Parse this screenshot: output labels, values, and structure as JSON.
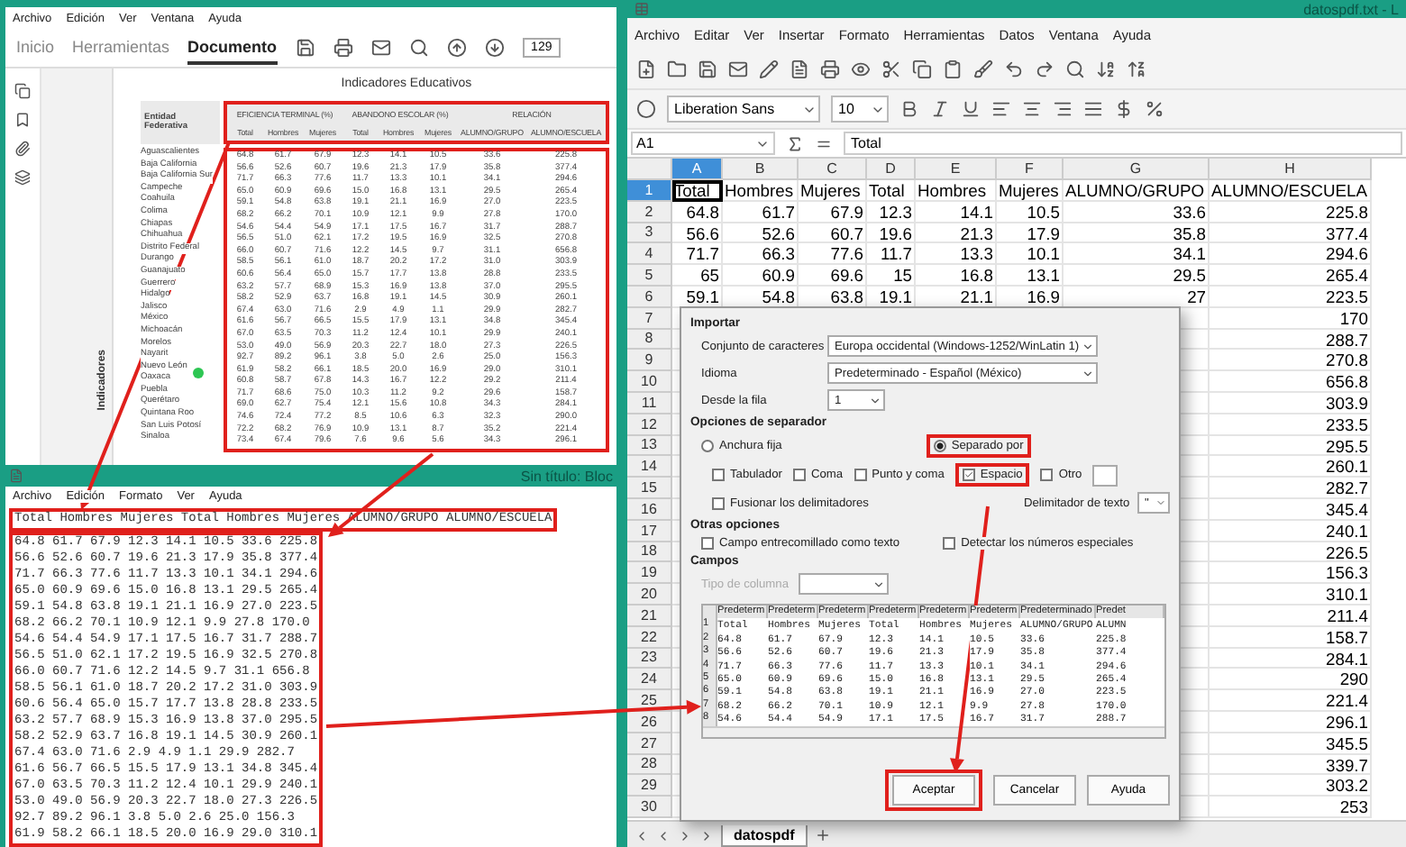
{
  "pdf_viewer": {
    "menu": [
      "Archivo",
      "Edición",
      "Ver",
      "Ventana",
      "Ayuda"
    ],
    "tabs": [
      {
        "label": "Inicio",
        "selected": false
      },
      {
        "label": "Herramientas",
        "selected": false
      },
      {
        "label": "Documento",
        "selected": true
      }
    ],
    "page_number": "129",
    "side_panel_label": "Indicadores",
    "document_title": "Indicadores Educativos",
    "table": {
      "row_header": "Entidad Federativa",
      "group_headers": [
        "EFICIENCIA TERMINAL (%)",
        "ABANDONO ESCOLAR (%)",
        "RELACIÓN"
      ],
      "columns": [
        "Total",
        "Hombres",
        "Mujeres",
        "Total",
        "Hombres",
        "Mujeres",
        "ALUMNO/GRUPO",
        "ALUMNO/ESCUELA"
      ],
      "rows": [
        {
          "entity": "Aguascalientes",
          "values": [
            "64.8",
            "61.7",
            "67.9",
            "12.3",
            "14.1",
            "10.5",
            "33.6",
            "225.8"
          ]
        },
        {
          "entity": "Baja California",
          "values": [
            "56.6",
            "52.6",
            "60.7",
            "19.6",
            "21.3",
            "17.9",
            "35.8",
            "377.4"
          ]
        },
        {
          "entity": "Baja California Sur",
          "values": [
            "71.7",
            "66.3",
            "77.6",
            "11.7",
            "13.3",
            "10.1",
            "34.1",
            "294.6"
          ]
        },
        {
          "entity": "Campeche",
          "values": [
            "65.0",
            "60.9",
            "69.6",
            "15.0",
            "16.8",
            "13.1",
            "29.5",
            "265.4"
          ]
        },
        {
          "entity": "Coahuila",
          "values": [
            "59.1",
            "54.8",
            "63.8",
            "19.1",
            "21.1",
            "16.9",
            "27.0",
            "223.5"
          ]
        },
        {
          "entity": "Colima",
          "values": [
            "68.2",
            "66.2",
            "70.1",
            "10.9",
            "12.1",
            "9.9",
            "27.8",
            "170.0"
          ]
        },
        {
          "entity": "Chiapas",
          "values": [
            "54.6",
            "54.4",
            "54.9",
            "17.1",
            "17.5",
            "16.7",
            "31.7",
            "288.7"
          ]
        },
        {
          "entity": "Chihuahua",
          "values": [
            "56.5",
            "51.0",
            "62.1",
            "17.2",
            "19.5",
            "16.9",
            "32.5",
            "270.8"
          ]
        },
        {
          "entity": "Distrito Federal",
          "values": [
            "66.0",
            "60.7",
            "71.6",
            "12.2",
            "14.5",
            "9.7",
            "31.1",
            "656.8"
          ]
        },
        {
          "entity": "Durango",
          "values": [
            "58.5",
            "56.1",
            "61.0",
            "18.7",
            "20.2",
            "17.2",
            "31.0",
            "303.9"
          ]
        },
        {
          "entity": "Guanajuato",
          "values": [
            "60.6",
            "56.4",
            "65.0",
            "15.7",
            "17.7",
            "13.8",
            "28.8",
            "233.5"
          ]
        },
        {
          "entity": "Guerrero",
          "values": [
            "63.2",
            "57.7",
            "68.9",
            "15.3",
            "16.9",
            "13.8",
            "37.0",
            "295.5"
          ]
        },
        {
          "entity": "Hidalgo",
          "values": [
            "58.2",
            "52.9",
            "63.7",
            "16.8",
            "19.1",
            "14.5",
            "30.9",
            "260.1"
          ]
        },
        {
          "entity": "Jalisco",
          "values": [
            "67.4",
            "63.0",
            "71.6",
            "2.9",
            "4.9",
            "1.1",
            "29.9",
            "282.7"
          ]
        },
        {
          "entity": "México",
          "values": [
            "61.6",
            "56.7",
            "66.5",
            "15.5",
            "17.9",
            "13.1",
            "34.8",
            "345.4"
          ]
        },
        {
          "entity": "Michoacán",
          "values": [
            "67.0",
            "63.5",
            "70.3",
            "11.2",
            "12.4",
            "10.1",
            "29.9",
            "240.1"
          ]
        },
        {
          "entity": "Morelos",
          "values": [
            "53.0",
            "49.0",
            "56.9",
            "20.3",
            "22.7",
            "18.0",
            "27.3",
            "226.5"
          ]
        },
        {
          "entity": "Nayarit",
          "values": [
            "92.7",
            "89.2",
            "96.1",
            "3.8",
            "5.0",
            "2.6",
            "25.0",
            "156.3"
          ]
        },
        {
          "entity": "Nuevo León",
          "values": [
            "61.9",
            "58.2",
            "66.1",
            "18.5",
            "20.0",
            "16.9",
            "29.0",
            "310.1"
          ]
        },
        {
          "entity": "Oaxaca",
          "values": [
            "60.8",
            "58.7",
            "67.8",
            "14.3",
            "16.7",
            "12.2",
            "29.2",
            "211.4"
          ]
        },
        {
          "entity": "Puebla",
          "values": [
            "71.7",
            "68.6",
            "75.0",
            "10.3",
            "11.2",
            "9.2",
            "29.6",
            "158.7"
          ]
        },
        {
          "entity": "Querétaro",
          "values": [
            "69.0",
            "62.7",
            "75.4",
            "12.1",
            "15.6",
            "10.8",
            "34.3",
            "284.1"
          ]
        },
        {
          "entity": "Quintana Roo",
          "values": [
            "74.6",
            "72.4",
            "77.2",
            "8.5",
            "10.6",
            "6.3",
            "32.3",
            "290.0"
          ]
        },
        {
          "entity": "San Luis Potosí",
          "values": [
            "72.2",
            "68.2",
            "76.9",
            "10.9",
            "13.1",
            "8.7",
            "35.2",
            "221.4"
          ]
        },
        {
          "entity": "Sinaloa",
          "values": [
            "73.4",
            "67.4",
            "79.6",
            "7.6",
            "9.6",
            "5.6",
            "34.3",
            "296.1"
          ]
        }
      ]
    }
  },
  "notepad": {
    "title": "Sin título: Bloc",
    "menu": [
      "Archivo",
      "Edición",
      "Formato",
      "Ver",
      "Ayuda"
    ],
    "lines": [
      "Total Hombres Mujeres Total Hombres Mujeres ALUMNO/GRUPO ALUMNO/ESCUELA",
      "64.8 61.7 67.9 12.3 14.1 10.5 33.6 225.8",
      "56.6 52.6 60.7 19.6 21.3 17.9 35.8 377.4",
      "71.7 66.3 77.6 11.7 13.3 10.1 34.1 294.6",
      "65.0 60.9 69.6 15.0 16.8 13.1 29.5 265.4",
      "59.1 54.8 63.8 19.1 21.1 16.9 27.0 223.5",
      "68.2 66.2 70.1 10.9 12.1 9.9 27.8 170.0",
      "54.6 54.4 54.9 17.1 17.5 16.7 31.7 288.7",
      "56.5 51.0 62.1 17.2 19.5 16.9 32.5 270.8",
      "66.0 60.7 71.6 12.2 14.5 9.7 31.1 656.8",
      "58.5 56.1 61.0 18.7 20.2 17.2 31.0 303.9",
      "60.6 56.4 65.0 15.7 17.7 13.8 28.8 233.5",
      "63.2 57.7 68.9 15.3 16.9 13.8 37.0 295.5",
      "58.2 52.9 63.7 16.8 19.1 14.5 30.9 260.1",
      "67.4 63.0 71.6 2.9 4.9 1.1 29.9 282.7",
      "61.6 56.7 66.5 15.5 17.9 13.1 34.8 345.4",
      "67.0 63.5 70.3 11.2 12.4 10.1 29.9 240.1",
      "53.0 49.0 56.9 20.3 22.7 18.0 27.3 226.5",
      "92.7 89.2 96.1 3.8 5.0 2.6 25.0 156.3",
      "61.9 58.2 66.1 18.5 20.0 16.9 29.0 310.1"
    ]
  },
  "spreadsheet": {
    "title": "datospdf.txt - L",
    "menu": [
      "Archivo",
      "Editar",
      "Ver",
      "Insertar",
      "Formato",
      "Herramientas",
      "Datos",
      "Ventana",
      "Ayuda"
    ],
    "font_name": "Liberation Sans",
    "font_size": "10",
    "name_box": "A1",
    "formula": "Total",
    "columns": [
      {
        "label": "A",
        "selected": true
      },
      {
        "label": "B",
        "selected": false
      },
      {
        "label": "C",
        "selected": false
      },
      {
        "label": "D",
        "selected": false
      },
      {
        "label": "E",
        "selected": false
      },
      {
        "label": "F",
        "selected": false
      },
      {
        "label": "G",
        "selected": false
      },
      {
        "label": "H",
        "selected": false
      }
    ],
    "rows": [
      {
        "number": "1",
        "selected": true,
        "cells": [
          "Total",
          "Hombres",
          "Mujeres",
          "Total",
          "Hombres",
          "Mujeres",
          "ALUMNO/GRUPO",
          "ALUMNO/ESCUELA"
        ]
      },
      {
        "number": "2",
        "selected": false,
        "cells": [
          "64.8",
          "61.7",
          "67.9",
          "12.3",
          "14.1",
          "10.5",
          "33.6",
          "225.8"
        ]
      },
      {
        "number": "3",
        "selected": false,
        "cells": [
          "56.6",
          "52.6",
          "60.7",
          "19.6",
          "21.3",
          "17.9",
          "35.8",
          "377.4"
        ]
      },
      {
        "number": "4",
        "selected": false,
        "cells": [
          "71.7",
          "66.3",
          "77.6",
          "11.7",
          "13.3",
          "10.1",
          "34.1",
          "294.6"
        ]
      },
      {
        "number": "5",
        "selected": false,
        "cells": [
          "65",
          "60.9",
          "69.6",
          "15",
          "16.8",
          "13.1",
          "29.5",
          "265.4"
        ]
      },
      {
        "number": "6",
        "selected": false,
        "cells": [
          "59.1",
          "54.8",
          "63.8",
          "19.1",
          "21.1",
          "16.9",
          "27",
          "223.5"
        ]
      },
      {
        "number": "7",
        "selected": false,
        "h": "170"
      },
      {
        "number": "8",
        "selected": false,
        "h": "288.7"
      },
      {
        "number": "9",
        "selected": false,
        "h": "270.8"
      },
      {
        "number": "10",
        "selected": false,
        "h": "656.8"
      },
      {
        "number": "11",
        "selected": false,
        "h": "303.9"
      },
      {
        "number": "12",
        "selected": false,
        "h": "233.5"
      },
      {
        "number": "13",
        "selected": false,
        "h": "295.5"
      },
      {
        "number": "14",
        "selected": false,
        "h": "260.1"
      },
      {
        "number": "15",
        "selected": false,
        "h": "282.7"
      },
      {
        "number": "16",
        "selected": false,
        "h": "345.4"
      },
      {
        "number": "17",
        "selected": false,
        "h": "240.1"
      },
      {
        "number": "18",
        "selected": false,
        "h": "226.5"
      },
      {
        "number": "19",
        "selected": false,
        "h": "156.3"
      },
      {
        "number": "20",
        "selected": false,
        "h": "310.1"
      },
      {
        "number": "21",
        "selected": false,
        "h": "211.4"
      },
      {
        "number": "22",
        "selected": false,
        "h": "158.7"
      },
      {
        "number": "23",
        "selected": false,
        "h": "284.1"
      },
      {
        "number": "24",
        "selected": false,
        "h": "290"
      },
      {
        "number": "25",
        "selected": false,
        "h": "221.4"
      },
      {
        "number": "26",
        "selected": false,
        "h": "296.1"
      },
      {
        "number": "27",
        "selected": false,
        "h": "345.5"
      },
      {
        "number": "28",
        "selected": false,
        "h": "339.7"
      },
      {
        "number": "29",
        "selected": false,
        "h": "303.2"
      },
      {
        "number": "30",
        "selected": false,
        "h": "253"
      }
    ],
    "sheet_tab": "datospdf"
  },
  "import_dialog": {
    "import_heading": "Importar",
    "fields": [
      {
        "label": "Conjunto de caracteres",
        "value": "Europa occidental (Windows-1252/WinLatin 1)",
        "kind": "dropdown"
      },
      {
        "label": "Idioma",
        "value": "Predeterminado - Español (México)",
        "kind": "dropdown"
      },
      {
        "label": "Desde la fila",
        "value": "1",
        "kind": "spin"
      }
    ],
    "separator_heading": "Opciones de separador",
    "separator_modes": [
      {
        "label": "Anchura fija",
        "selected": false
      },
      {
        "label": "Separado por",
        "selected": true
      }
    ],
    "separators": [
      {
        "label": "Tabulador",
        "checked": false
      },
      {
        "label": "Coma",
        "checked": false
      },
      {
        "label": "Punto y coma",
        "checked": false
      },
      {
        "label": "Espacio",
        "checked": true
      },
      {
        "label": "Otro",
        "checked": false
      }
    ],
    "merge_delimiters": {
      "label": "Fusionar los delimitadores",
      "checked": false
    },
    "text_delimiter": {
      "label": "Delimitador de texto",
      "value": "\""
    },
    "other_heading": "Otras opciones",
    "other_options": [
      {
        "label": "Campo entrecomillado como texto",
        "checked": false
      },
      {
        "label": "Detectar los números especiales",
        "checked": false
      }
    ],
    "fields_heading": "Campos",
    "column_type_label": "Tipo de columna",
    "preview": {
      "columns": [
        "Predeterm",
        "Predeterm",
        "Predeterm",
        "Predeterm",
        "Predeterm",
        "Predeterm",
        "Predeterminado",
        "Predet"
      ],
      "rows": [
        {
          "number": "1",
          "cells": [
            "Total",
            "Hombres",
            "Mujeres",
            "Total",
            "Hombres",
            "Mujeres",
            "ALUMNO/GRUPO",
            "ALUMN"
          ]
        },
        {
          "number": "2",
          "cells": [
            "64.8",
            "61.7",
            "67.9",
            "12.3",
            "14.1",
            "10.5",
            "33.6",
            "225.8"
          ]
        },
        {
          "number": "3",
          "cells": [
            "56.6",
            "52.6",
            "60.7",
            "19.6",
            "21.3",
            "17.9",
            "35.8",
            "377.4"
          ]
        },
        {
          "number": "4",
          "cells": [
            "71.7",
            "66.3",
            "77.6",
            "11.7",
            "13.3",
            "10.1",
            "34.1",
            "294.6"
          ]
        },
        {
          "number": "5",
          "cells": [
            "65.0",
            "60.9",
            "69.6",
            "15.0",
            "16.8",
            "13.1",
            "29.5",
            "265.4"
          ]
        },
        {
          "number": "6",
          "cells": [
            "59.1",
            "54.8",
            "63.8",
            "19.1",
            "21.1",
            "16.9",
            "27.0",
            "223.5"
          ]
        },
        {
          "number": "7",
          "cells": [
            "68.2",
            "66.2",
            "70.1",
            "10.9",
            "12.1",
            "9.9",
            "27.8",
            "170.0"
          ]
        },
        {
          "number": "8",
          "cells": [
            "54.6",
            "54.4",
            "54.9",
            "17.1",
            "17.5",
            "16.7",
            "31.7",
            "288.7"
          ]
        }
      ]
    },
    "buttons": [
      "Aceptar",
      "Cancelar",
      "Ayuda"
    ]
  }
}
